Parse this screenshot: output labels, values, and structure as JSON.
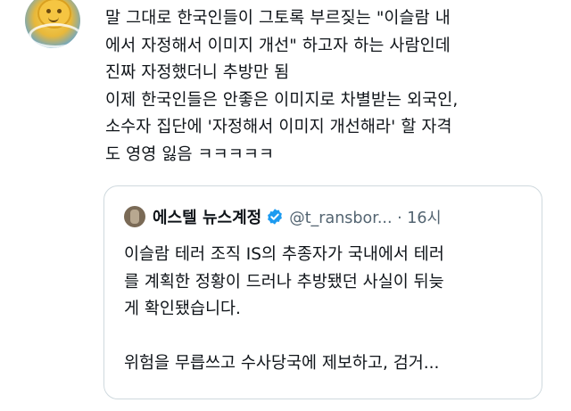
{
  "tweet": {
    "lines": [
      "말 그대로 한국인들이 그토록 부르짖는 \"이슬람 내",
      "에서 자정해서 이미지 개선\" 하고자 하는 사람인데",
      "진짜 자정했더니 추방만 됨",
      "이제 한국인들은 안좋은 이미지로 차별받는 외국인,",
      "소수자 집단에 '자정해서 이미지 개선해라' 할 자격",
      "도 영영 잃음 ㅋㅋㅋㅋㅋ"
    ]
  },
  "quote": {
    "name": "에스텔 뉴스계정",
    "handle_time": "@t_ransbor... · 16시",
    "body_lines": [
      "이슬람 테러 조직 IS의 추종자가 국내에서 테러",
      "를 계획한 정황이 드러나 추방됐던 사실이 뒤늦",
      "게 확인됐습니다."
    ],
    "body_lines_2": [
      "위험을 무릅쓰고 수사당국에 제보하고, 검거..."
    ]
  },
  "colors": {
    "text": "#0f1419",
    "muted": "#536471",
    "verified": "#1d9bf0",
    "border": "#cfd9de"
  }
}
